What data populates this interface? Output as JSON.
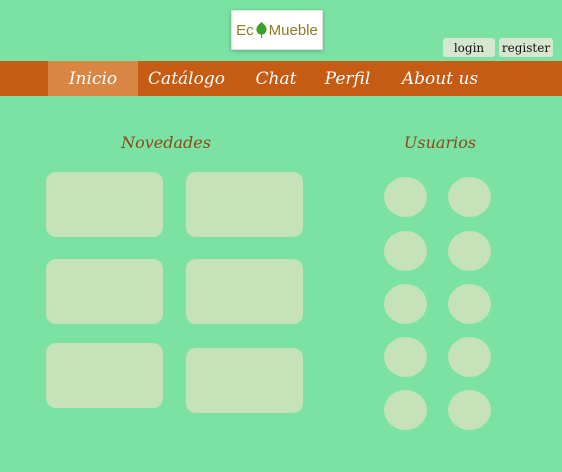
{
  "logo": {
    "text_before": "Ec",
    "text_after": "Mueble"
  },
  "auth": {
    "login_label": "login",
    "register_label": "register"
  },
  "nav": {
    "items": [
      {
        "label": "Inicio"
      },
      {
        "label": "Catálogo"
      },
      {
        "label": "Chat"
      },
      {
        "label": "Perfil"
      },
      {
        "label": "About us"
      }
    ],
    "active": "Inicio"
  },
  "sections": {
    "news_title": "Novedades",
    "users_title": "Usuarios"
  },
  "colors": {
    "background": "#7ce2a3",
    "nav": "#c65b13",
    "nav_active": "#d98645",
    "placeholder": "#c6e2b8",
    "heading": "#8a4a19"
  }
}
